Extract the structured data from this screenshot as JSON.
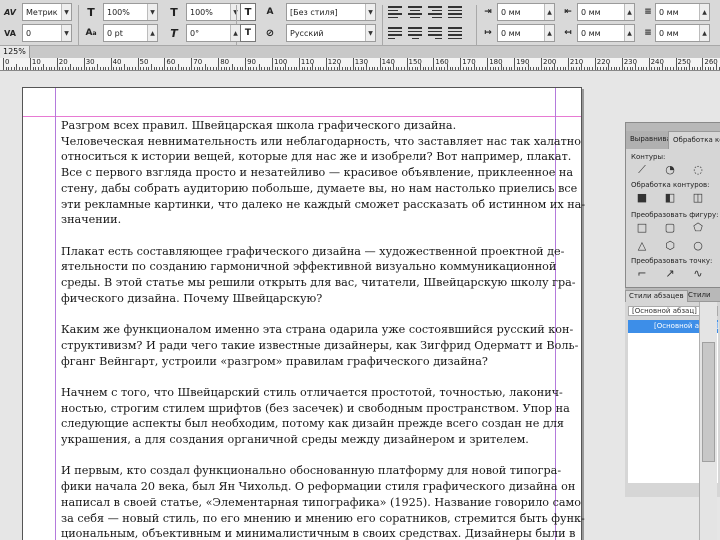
{
  "control_bar": {
    "kerning_icon": "AV-kerning-icon",
    "kerning_value": "Метрик",
    "tracking_value": "0",
    "vertical_scale_value": "100%",
    "horizontal_scale_value": "100%",
    "baseline_value": "0 pt",
    "skew_value": "0°",
    "character_style_value": "[Без стиля]",
    "language_value": "Русский",
    "indent_values": [
      "0 мм",
      "0 мм",
      "0 мм",
      "0 мм"
    ],
    "spacing_values": [
      "0 мм",
      "0 мм",
      "0",
      "0"
    ]
  },
  "document": {
    "zoom": "125%"
  },
  "ruler": {
    "labels": [
      "0",
      "10",
      "20",
      "30",
      "40",
      "50",
      "60",
      "70",
      "80",
      "90",
      "100",
      "110",
      "120",
      "130",
      "140",
      "150",
      "160",
      "170",
      "180",
      "190",
      "200",
      "210",
      "220",
      "230",
      "240",
      "250",
      "260"
    ]
  },
  "text": {
    "paragraphs": [
      [
        "Разгром всех правил. Швейцарская школа графического дизайна.",
        "Человеческая невнимательность или неблагодарность, что заставляет нас так халатно",
        "относиться к истории вещей, которые для нас же и изобрели? Вот например, плакат.",
        "Все с первого взгляда просто и незатейливо — красивое объявление, приклеенное на",
        "стену, дабы собрать аудиторию побольше, думаете вы, но нам настолько приелись все",
        "эти рекламные картинки, что далеко не каждый сможет рассказать об истинном их на-",
        "значении."
      ],
      [
        "Плакат есть составляющее графического дизайна — художественной проектной де-",
        "ятельности по созданию гармоничной эффективной визуально коммуникационной",
        "среды. В этой статье мы решили открыть для вас, читатели, Швейцарскую школу гра-",
        "фического дизайна. Почему Швейцарскую?"
      ],
      [
        "Каким же функционалом именно эта страна одарила уже состоявшийся русский кон-",
        "структивизм? И ради чего такие известные дизайнеры, как Зигфрид Одерматт и Воль-",
        "фганг Вейнгарт, устроили «разгром» правилам графического дизайна?"
      ],
      [
        "Начнем с того, что Швейцарский стиль отличается простотой, точностью, лаконич-",
        "ностью, строгим стилем шрифтов (без засечек) и свободным пространством. Упор на",
        "следующие аспекты был необходим, потому как дизайн прежде всего создан не для",
        "украшения, а для создания органичной среды между дизайнером и зрителем."
      ],
      [
        "И первым, кто создал функционально обоснованную платформу для новой типогра-",
        "фики начала 20 века, был Ян Чихольд. О реформации стиля графического дизайна он",
        "написал в своей статье, «Элементарная типографика» (1925). Название говорило само",
        "за себя — новый стиль, по его мнению и мнению его соратников, стремится быть функ-",
        "циональным, объективным и минималистичным в своих средствах. Дизайнеры были в"
      ]
    ]
  },
  "pathfinder_panel": {
    "tab_inactive": "Выравниван",
    "tab_active": "Обработка конт",
    "sections": [
      "Контуры:",
      "Обработка контуров:",
      "Преобразовать фигуру:",
      "Преобразовать точку:"
    ]
  },
  "styles_panel": {
    "tab_active": "Стили абзацев",
    "tab_inactive": "Стили",
    "base_style": "[Основной абзац]",
    "selected_style": "[Основной абзац]"
  }
}
